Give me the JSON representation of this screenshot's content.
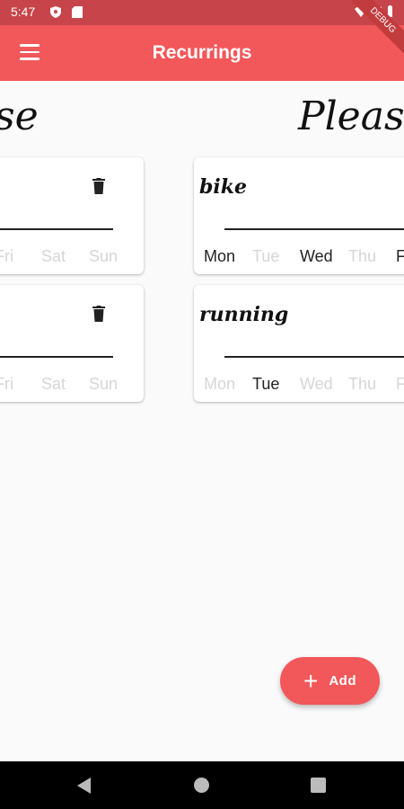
{
  "status_bar": {
    "time": "5:47",
    "debug_label": "DEBUG"
  },
  "app_bar": {
    "title": "Recurrings"
  },
  "sections": [
    {
      "title": "se",
      "cards": [
        {
          "name": "",
          "days": [
            {
              "label": "Fri",
              "active": false
            },
            {
              "label": "Sat",
              "active": false
            },
            {
              "label": "Sun",
              "active": false
            }
          ]
        },
        {
          "name": "",
          "days": [
            {
              "label": "Fri",
              "active": false
            },
            {
              "label": "Sat",
              "active": false
            },
            {
              "label": "Sun",
              "active": false
            }
          ]
        }
      ]
    },
    {
      "title": "Pleasu",
      "cards": [
        {
          "name": "bike",
          "days": [
            {
              "label": "Mon",
              "active": true
            },
            {
              "label": "Tue",
              "active": false
            },
            {
              "label": "Wed",
              "active": true
            },
            {
              "label": "Thu",
              "active": false
            },
            {
              "label": "F",
              "active": true
            }
          ]
        },
        {
          "name": "running",
          "days": [
            {
              "label": "Mon",
              "active": false
            },
            {
              "label": "Tue",
              "active": true
            },
            {
              "label": "Wed",
              "active": false
            },
            {
              "label": "Thu",
              "active": false
            },
            {
              "label": "F",
              "active": false
            }
          ]
        }
      ]
    }
  ],
  "fab": {
    "label": "Add",
    "icon": "plus-icon"
  },
  "colors": {
    "primary": "#f2575a",
    "status_bar": "#c7454a",
    "active_day": "#222222",
    "inactive_day": "#d6d6d6"
  }
}
